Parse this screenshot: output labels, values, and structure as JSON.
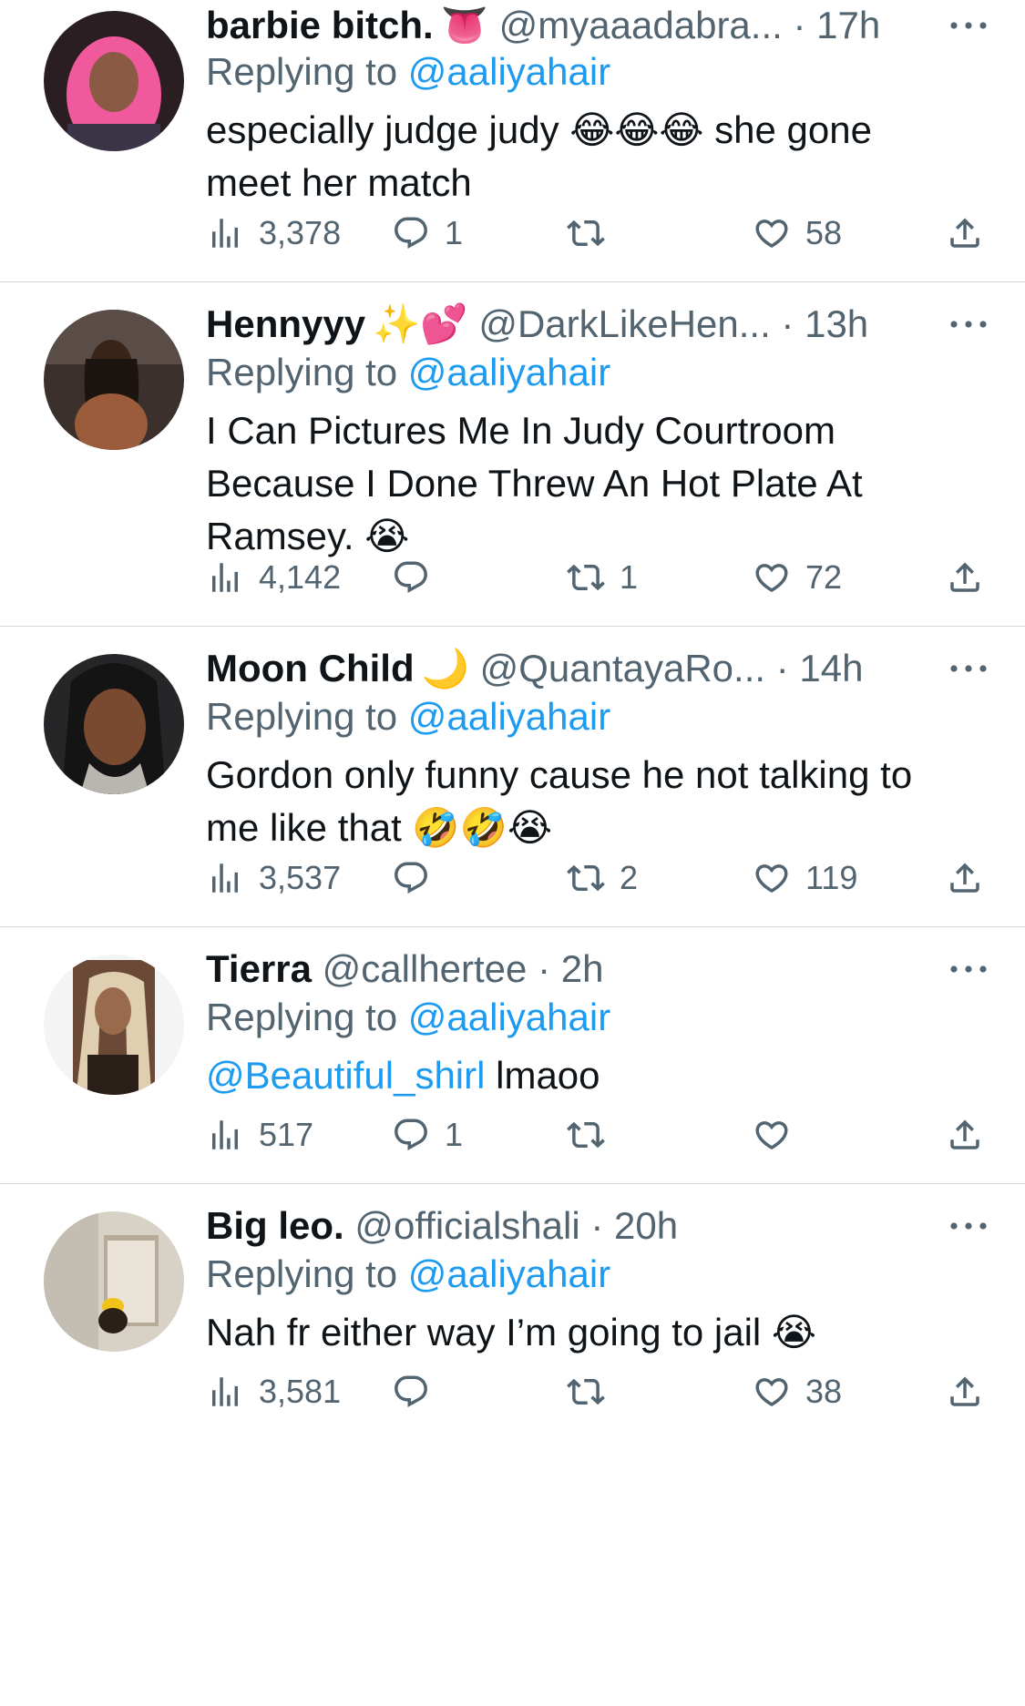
{
  "replying_label": "Replying to ",
  "replying_handle": "@aaliyahair",
  "tweets": [
    {
      "name": "barbie bitch.",
      "name_emoji": "👅",
      "handle": "@myaaadabra...",
      "dot": " · ",
      "time": "17h",
      "text_lines": [
        "especially judge judy 😂😂😂 she gone",
        "meet her match"
      ],
      "views": "3,378",
      "replies": "1",
      "retweets": "",
      "likes": "58"
    },
    {
      "name": "Hennyyy",
      "name_emoji": "✨💕",
      "handle": "@DarkLikeHen...",
      "dot": " · ",
      "time": "13h",
      "text_lines": [
        "I Can Pictures Me In Judy Courtroom",
        "Because I Done Threw An Hot Plate At",
        "Ramsey. 😭"
      ],
      "views": "4,142",
      "replies": "",
      "retweets": "1",
      "likes": "72"
    },
    {
      "name": "Moon Child",
      "name_emoji": "🌙",
      "handle": "@QuantayaRo...",
      "dot": " · ",
      "time": "14h",
      "text_lines": [
        "Gordon only funny cause he not talking to",
        "me like that 🤣🤣😭"
      ],
      "views": "3,537",
      "replies": "",
      "retweets": "2",
      "likes": "119"
    },
    {
      "name": "Tierra",
      "name_emoji": "",
      "handle": "@callhertee",
      "dot": " · ",
      "time": "2h",
      "text_mention": "@Beautiful_shirl",
      "text_rest": " lmaoo",
      "views": "517",
      "replies": "1",
      "retweets": "",
      "likes": ""
    },
    {
      "name": "Big leo.",
      "name_emoji": "",
      "handle": "@officialshali",
      "dot": " · ",
      "time": "20h",
      "text_lines": [
        "Nah fr either way I’m going to jail 😭"
      ],
      "views": "3,581",
      "replies": "",
      "retweets": "",
      "likes": "38"
    }
  ],
  "colors": {
    "text": "#0f1419",
    "secondary": "#536471",
    "link": "#1d9bf0",
    "divider": "#cfd9de"
  }
}
